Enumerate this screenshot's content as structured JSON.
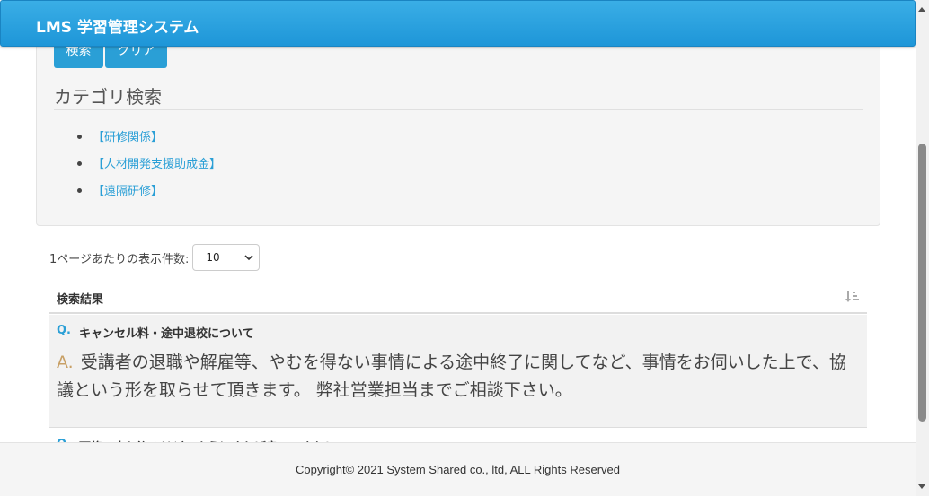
{
  "navbar": {
    "brand": "LMS 学習管理システム"
  },
  "search": {
    "search_button": "検索",
    "clear_button": "クリア"
  },
  "category": {
    "title": "カテゴリ検索",
    "items": [
      {
        "label": "【研修関係】"
      },
      {
        "label": "【人材開発支援助成金】"
      },
      {
        "label": "【遠隔研修】"
      }
    ]
  },
  "pagination": {
    "per_page_label": "1ページあたりの表示件数:",
    "per_page_value": "10"
  },
  "results": {
    "header": "検索結果",
    "sort_icon": "sort-amount-desc-icon",
    "items": [
      {
        "q_mark": "Q.",
        "question": "キャンセル料・途中退校について",
        "a_mark": "A.",
        "answer": "受講者の退職や解雇等、やむを得ない事情による途中終了に関してなど、事情をお伺いした上で、協議という形を取らせて頂きます。 弊社営業担当までご相談下さい。"
      },
      {
        "q_mark": "Q.",
        "question": "研修の申し込みはどのようにすれば良いですか？"
      }
    ]
  },
  "footer": {
    "copyright": "Copyright© 2021 System Shared co., ltd, ALL Rights Reserved"
  },
  "colors": {
    "accent": "#2a9fd6",
    "answer_mark": "#c8a066",
    "panel_bg": "#f5f5f5"
  }
}
